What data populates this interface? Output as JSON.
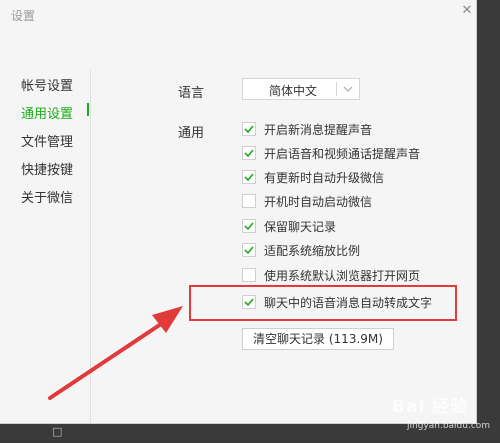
{
  "window": {
    "title": "设置",
    "close_glyph": "✕"
  },
  "sidebar": {
    "items": [
      {
        "label": "帐号设置"
      },
      {
        "label": "通用设置",
        "active": true
      },
      {
        "label": "文件管理"
      },
      {
        "label": "快捷按键"
      },
      {
        "label": "关于微信"
      }
    ]
  },
  "general": {
    "language_label": "语言",
    "language_value": "简体中文",
    "general_label": "通用",
    "options": [
      {
        "label": "开启新消息提醒声音",
        "checked": true
      },
      {
        "label": "开启语音和视频通话提醒声音",
        "checked": true
      },
      {
        "label": "有更新时自动升级微信",
        "checked": true
      },
      {
        "label": "开机时自动启动微信",
        "checked": false
      },
      {
        "label": "保留聊天记录",
        "checked": true
      },
      {
        "label": "适配系统缩放比例",
        "checked": true
      },
      {
        "label": "使用系统默认浏览器打开网页",
        "checked": false
      },
      {
        "label": "聊天中的语音消息自动转成文字",
        "checked": true
      }
    ],
    "clear_button": "清空聊天记录 (113.9M)"
  },
  "accent_color": "#1aad19",
  "annotation_color": "#e03a3a",
  "watermark": {
    "text": "Bai 经验",
    "sub": "jingyan.baidu.com"
  },
  "taskbar_icon": "□"
}
